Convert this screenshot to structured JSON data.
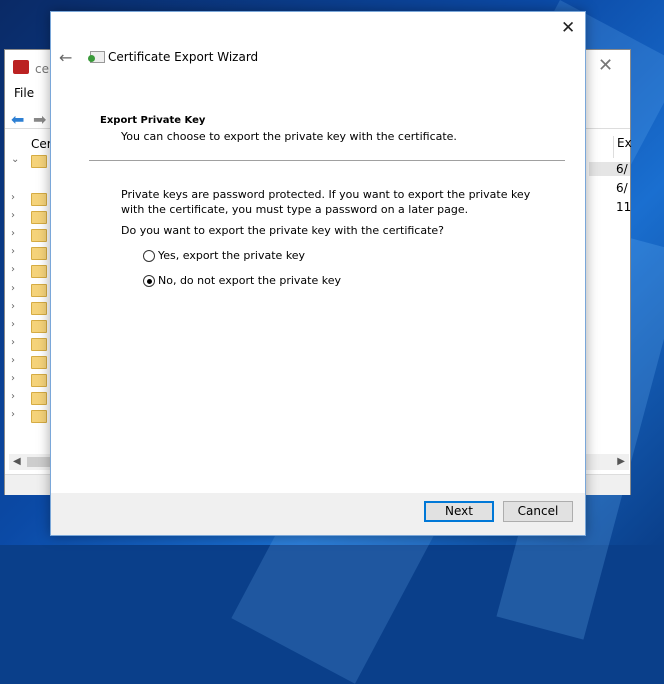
{
  "background_window": {
    "title_partial": "cer",
    "menu_file": "File",
    "tree_root_partial": "Cer",
    "column_header_partial": "Ex",
    "cells": [
      "6/",
      "6/",
      "11"
    ]
  },
  "wizard": {
    "title": "Certificate Export Wizard",
    "heading": "Export Private Key",
    "subheading": "You can choose to export the private key with the certificate.",
    "body": "Private keys are password protected. If you want to export the private key with the certificate, you must type a password on a later page.",
    "question": "Do you want to export the private key with the certificate?",
    "options": [
      {
        "label": "Yes, export the private key",
        "selected": false
      },
      {
        "label": "No, do not export the private key",
        "selected": true
      }
    ],
    "next_label": "Next",
    "cancel_label": "Cancel"
  }
}
